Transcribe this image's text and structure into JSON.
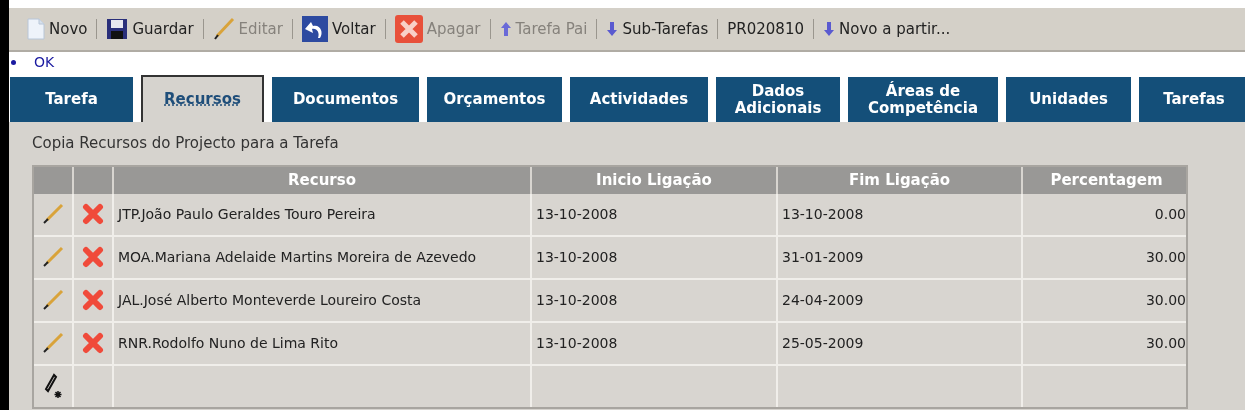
{
  "toolbar": [
    {
      "label": "Novo",
      "kind": "document",
      "disabled": false
    },
    {
      "label": "Guardar",
      "kind": "save",
      "disabled": false
    },
    {
      "label": "Editar",
      "kind": "pencil",
      "disabled": true
    },
    {
      "label": "Voltar",
      "kind": "undo",
      "disabled": false
    },
    {
      "label": "Apagar",
      "kind": "delete",
      "disabled": true
    },
    {
      "label": "Tarefa Pai",
      "kind": "up",
      "disabled": true
    },
    {
      "label": "Sub-Tarefas",
      "kind": "down",
      "disabled": false
    },
    {
      "label": "PR020810",
      "kind": "text",
      "disabled": false
    },
    {
      "label": "Novo a partir...",
      "kind": "down",
      "disabled": false
    }
  ],
  "messages": [
    "OK"
  ],
  "tabs": [
    {
      "label": "Tarefa",
      "selected": false
    },
    {
      "label": "Recursos",
      "selected": true
    },
    {
      "label": "Documentos",
      "selected": false
    },
    {
      "label": "Orçamentos",
      "selected": false
    },
    {
      "label": "Actividades",
      "selected": false
    },
    {
      "label": "Dados Adicionais",
      "selected": false
    },
    {
      "label": "Áreas de Competência",
      "selected": false
    },
    {
      "label": "Unidades",
      "selected": false
    },
    {
      "label": "Tarefas",
      "selected": false
    }
  ],
  "copy_link": "Copia Recursos do Projecto para a Tarefa",
  "table": {
    "columns": [
      "Recurso",
      "Inicio Ligação",
      "Fim Ligação",
      "Percentagem"
    ],
    "rows": [
      [
        "JTP.João Paulo Geraldes Touro Pereira",
        "13-10-2008",
        "13-10-2008",
        "0.00"
      ],
      [
        "MOA.Mariana Adelaide Martins Moreira de Azevedo",
        "13-10-2008",
        "31-01-2009",
        "30.00"
      ],
      [
        "JAL.José Alberto Monteverde Loureiro Costa",
        "13-10-2008",
        "24-04-2009",
        "30.00"
      ],
      [
        "RNR.Rodolfo Nuno de Lima Rito",
        "13-10-2008",
        "25-05-2009",
        "30.00"
      ]
    ]
  }
}
